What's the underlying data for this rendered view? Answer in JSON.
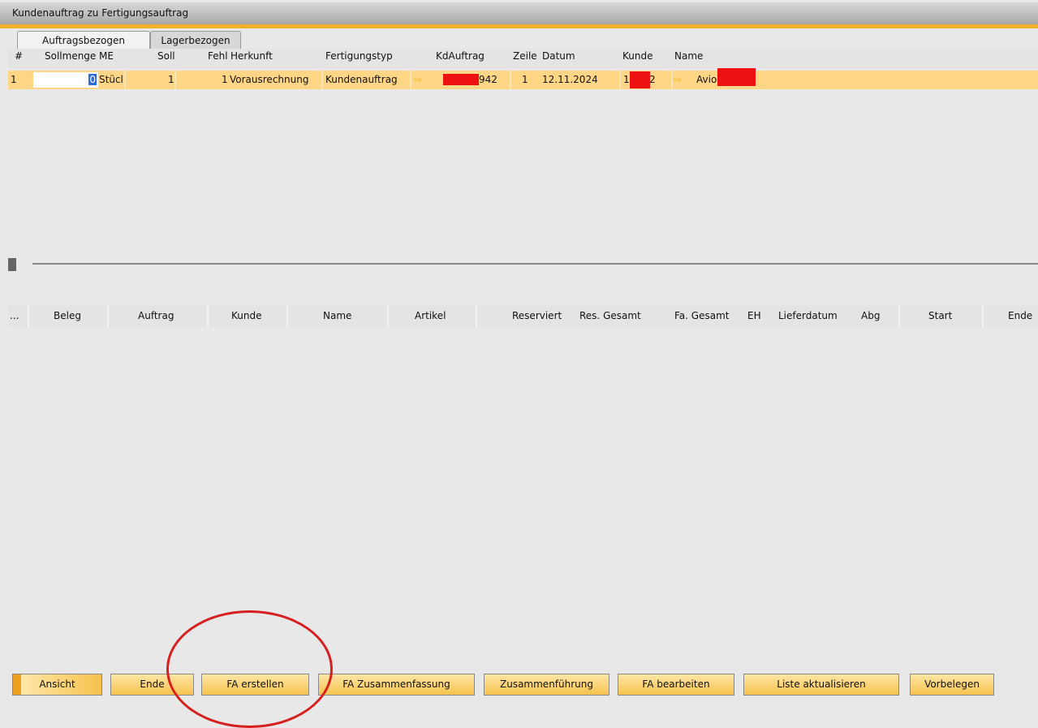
{
  "window": {
    "title": "Kundenauftrag zu Fertigungsauftrag"
  },
  "tabs": [
    {
      "label": "Auftragsbezogen",
      "active": true
    },
    {
      "label": "Lagerbezogen",
      "active": false
    }
  ],
  "grid1": {
    "columns": [
      "#",
      "Sollmenge",
      "ME",
      "Soll",
      "Fehl",
      "Herkunft",
      "Fertigungstyp",
      "KdAuftrag",
      "Zeile",
      "Datum",
      "Kunde",
      "Name"
    ],
    "row": {
      "num": "1",
      "sollmenge": "0",
      "me": "Stücl",
      "soll": "1",
      "fehl": "1",
      "herkunft": "Vorausrechnung",
      "fertigungstyp": "Kundenauftrag",
      "kdauftrag": "942",
      "zeile": "1",
      "datum": "12.11.2024",
      "kunde_pre": "1",
      "kunde_post": "2",
      "name": "Avio"
    }
  },
  "grid2": {
    "columns": [
      "...",
      "Beleg",
      "Auftrag",
      "Kunde",
      "Name",
      "Artikel",
      "Reserviert",
      "Res. Gesamt",
      "Fa. Gesamt",
      "EH",
      "Lieferdatum",
      "Abg",
      "Start",
      "Ende"
    ]
  },
  "buttons": [
    {
      "label": "Ansicht"
    },
    {
      "label": "Ende"
    },
    {
      "label": "FA erstellen"
    },
    {
      "label": "FA Zusammenfassung"
    },
    {
      "label": "Zusammenführung"
    },
    {
      "label": "FA bearbeiten"
    },
    {
      "label": "Liste aktualisieren"
    },
    {
      "label": "Vorbelegen"
    }
  ],
  "colors": {
    "accent": "#f3b02a",
    "row_highlight": "#ffd686",
    "redaction": "#ee1111",
    "annotation": "#d62020"
  },
  "icons": {
    "link_arrow": "arrow-right-icon"
  }
}
